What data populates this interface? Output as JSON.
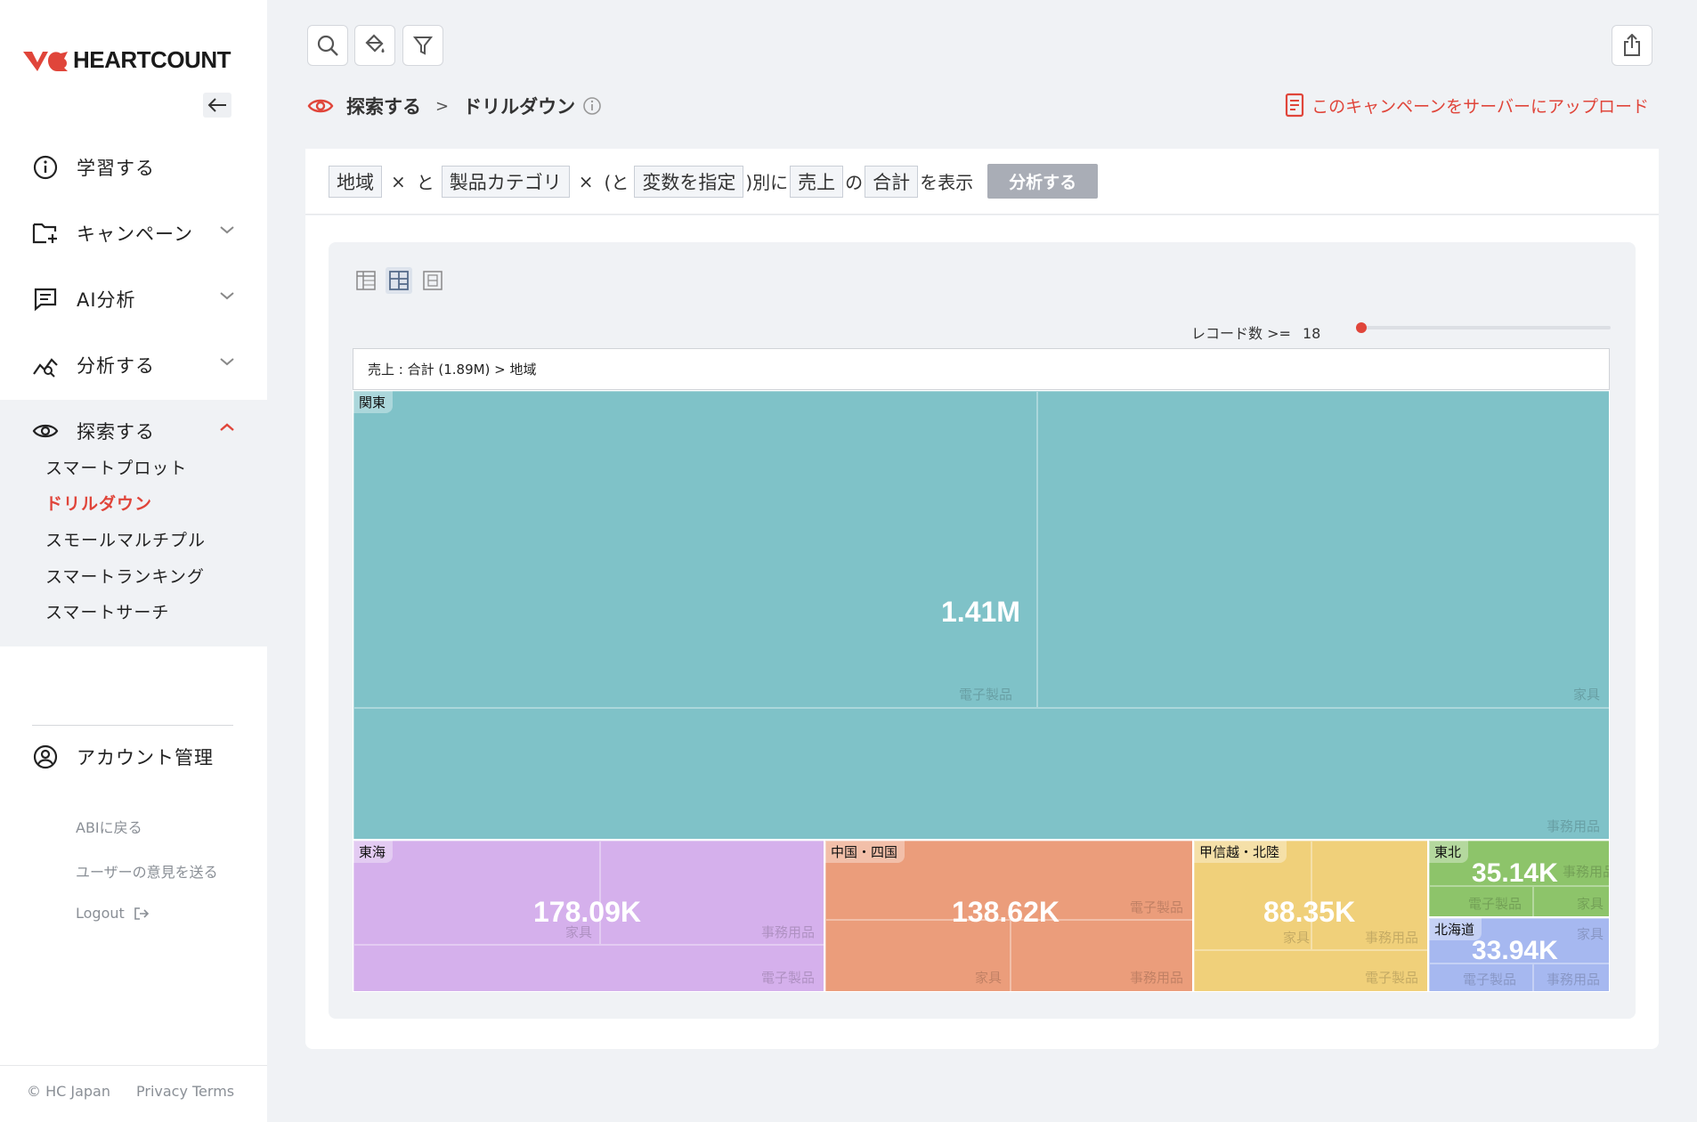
{
  "app": {
    "brand": "HEARTCOUNT",
    "accent": "#e0453a"
  },
  "sidebar": {
    "nav": [
      {
        "label": "学習する",
        "icon": "info-icon"
      },
      {
        "label": "キャンペーン",
        "icon": "folder-plus-icon"
      },
      {
        "label": "AI分析",
        "icon": "message-icon"
      },
      {
        "label": "分析する",
        "icon": "analytics-icon"
      },
      {
        "label": "探索する",
        "icon": "eye-icon"
      }
    ],
    "explore_sub": [
      "スマートプロット",
      "ドリルダウン",
      "スモールマルチプル",
      "スマートランキング",
      "スマートサーチ"
    ],
    "account": "アカウント管理",
    "links": [
      "ABIに戻る",
      "ユーザーの意見を送る",
      "Logout"
    ],
    "footer": {
      "copyright": "© HC Japan",
      "privacy": "Privacy",
      "terms": "Terms"
    }
  },
  "breadcrumb": {
    "root": "探索する",
    "sep": ">",
    "current": "ドリルダウン"
  },
  "upload": "このキャンペーンをサーバーにアップロード",
  "query": {
    "t1": "地域",
    "x1": "×",
    "and1": "と",
    "t2": "製品カテゴリ",
    "x2": "×",
    "and2": "(と",
    "t3": "変数を指定",
    "by": ")別に",
    "t4": "売上",
    "of": "の",
    "t5": "合計",
    "show": "を表示",
    "button": "分析する"
  },
  "filter": {
    "label": "レコード数 >=",
    "value": "18",
    "slider_fraction": 0.0
  },
  "chart_data": {
    "type": "treemap",
    "title": "売上 : 合計 (1.89M) > 地域",
    "regions": [
      {
        "name": "関東",
        "value_label": "1.41M",
        "color": "#7fc2c8",
        "categories": [
          "電子製品",
          "家具",
          "事務用品"
        ]
      },
      {
        "name": "東海",
        "value_label": "178.09K",
        "color": "#d5b0ec",
        "categories": [
          "家具",
          "事務用品",
          "電子製品"
        ]
      },
      {
        "name": "中国・四国",
        "value_label": "138.62K",
        "color": "#eb9d7b",
        "categories": [
          "電子製品",
          "家具",
          "事務用品"
        ]
      },
      {
        "name": "甲信越・北陸",
        "value_label": "88.35K",
        "color": "#f0d07a",
        "categories": [
          "家具",
          "事務用品",
          "電子製品"
        ]
      },
      {
        "name": "東北",
        "value_label": "35.14K",
        "color": "#8dc46a",
        "categories": [
          "事務用品",
          "電子製品",
          "家具"
        ]
      },
      {
        "name": "北海道",
        "value_label": "33.94K",
        "color": "#a6b8f0",
        "categories": [
          "家具",
          "電子製品",
          "事務用品"
        ]
      }
    ]
  }
}
